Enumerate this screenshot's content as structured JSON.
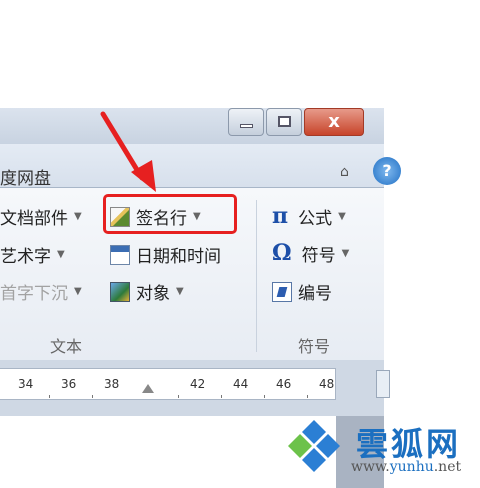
{
  "window": {
    "minimize_icon": "minimize-icon",
    "maximize_icon": "maximize-icon",
    "close_label": "x"
  },
  "tab": {
    "label": "度网盘"
  },
  "help": {
    "label": "?"
  },
  "ribbon": {
    "text_group": {
      "label": "文本",
      "items": [
        {
          "label": "文档部件",
          "icon": "quick-parts-icon"
        },
        {
          "label": "艺术字",
          "icon": "wordart-icon"
        },
        {
          "label": "首字下沉",
          "icon": "drop-cap-icon"
        }
      ],
      "signature_line": {
        "label": "签名行",
        "icon": "signature-line-icon"
      },
      "date_time": {
        "label": "日期和时间",
        "icon": "date-time-icon"
      },
      "object": {
        "label": "对象",
        "icon": "object-icon"
      }
    },
    "symbols_group": {
      "label": "符号",
      "equation": {
        "glyph": "π",
        "label": "公式"
      },
      "symbol": {
        "glyph": "Ω",
        "label": "符号"
      },
      "number": {
        "label": "编号",
        "icon": "numbering-icon"
      }
    }
  },
  "ruler": {
    "ticks": [
      "34",
      "36",
      "38",
      "42",
      "44",
      "46",
      "48"
    ]
  },
  "watermark": {
    "title": "雲狐网",
    "url_prefix": "www.",
    "url_brand": "yunhu",
    "url_suffix": ".net"
  },
  "colors": {
    "highlight": "#e62020",
    "arrow": "#e62020",
    "brand": "#1b6fc0"
  }
}
